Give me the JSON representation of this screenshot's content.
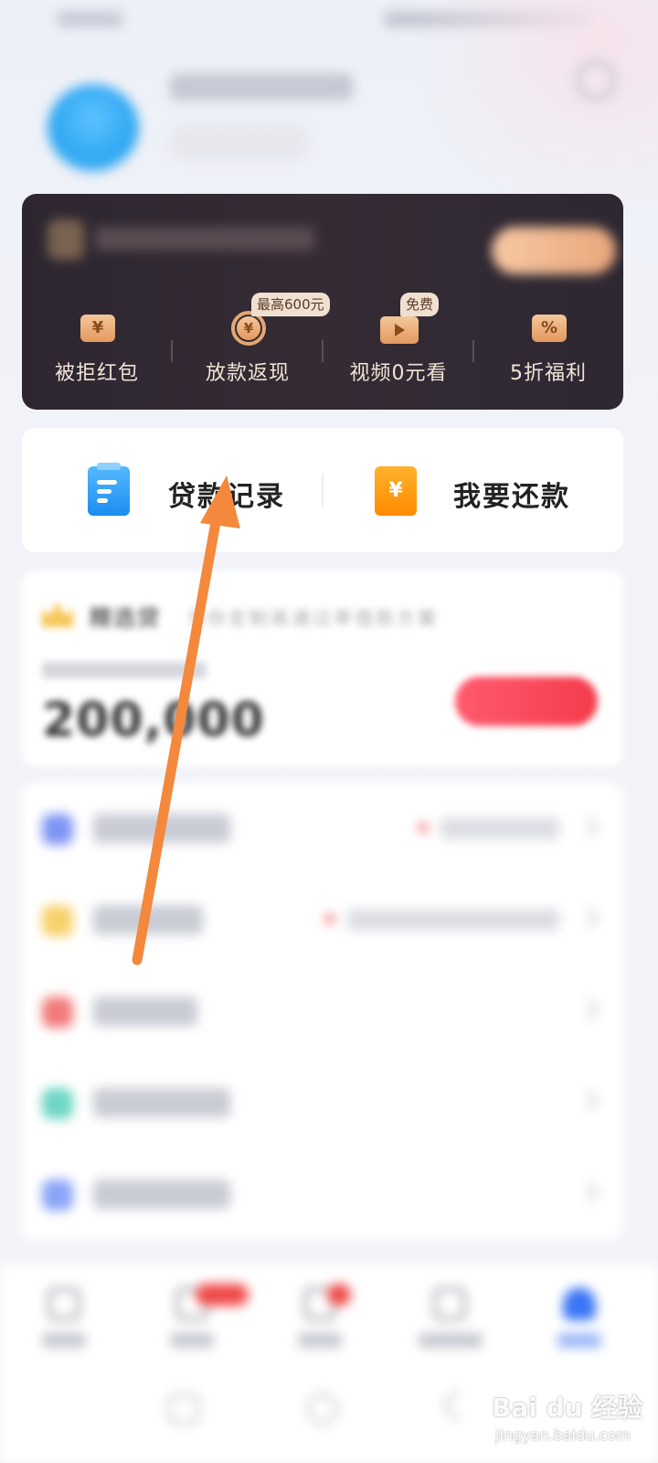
{
  "status_bar": {
    "time": "",
    "icons": ""
  },
  "profile": {
    "username": "",
    "member_tag": ""
  },
  "vip": {
    "title": "",
    "open_button": "",
    "benefits": [
      {
        "label": "被拒红包",
        "icon": "yen-ticket-icon"
      },
      {
        "label": "放款返现",
        "icon": "yen-coin-refresh-icon",
        "badge": "最高600元"
      },
      {
        "label": "视频0元看",
        "icon": "video-play-icon",
        "badge": "免费"
      },
      {
        "label": "5折福利",
        "icon": "percent-ticket-icon"
      }
    ],
    "colors": {
      "card": "#2f2832",
      "accent": "#e8a67c",
      "label": "#f2e4d6"
    }
  },
  "quick_actions": {
    "loan_record": {
      "label": "贷款记录",
      "icon": "document-icon",
      "color": "#1c8cf0"
    },
    "repay": {
      "label": "我要还款",
      "icon": "yen-card-icon",
      "glyph": "¥",
      "color": "#ff8a00"
    }
  },
  "selected_loan": {
    "title": "精选贷",
    "subtitle": "为你定制高通过率借款方案",
    "amount_hint": "",
    "amount": "200,000",
    "button": ""
  },
  "menu": {
    "items": [
      {
        "icon": "list-icon",
        "label": "",
        "extra": "",
        "color": "#7f95f5"
      },
      {
        "icon": "coupon-icon",
        "label": "",
        "extra": "",
        "color": "#f7d16a"
      },
      {
        "icon": "shield-icon",
        "label": "",
        "extra": "",
        "color": "#f27a7a"
      },
      {
        "icon": "help-icon",
        "label": "",
        "extra": "",
        "color": "#6fd6c4"
      },
      {
        "icon": "service-icon",
        "label": "",
        "extra": "",
        "color": "#8aa4f7"
      }
    ]
  },
  "bottom_nav": {
    "tabs": [
      {
        "icon": "home-icon",
        "label": ""
      },
      {
        "icon": "loan-icon",
        "label": "",
        "badge": ""
      },
      {
        "icon": "message-icon",
        "label": "",
        "badge": ""
      },
      {
        "icon": "card-icon",
        "label": ""
      },
      {
        "icon": "profile-icon",
        "label": "",
        "active": true
      }
    ]
  },
  "annotation": {
    "arrow_color": "#f4883c"
  },
  "watermark": {
    "brand": "Bai du 经验",
    "url": "jingyan.baidu.com"
  }
}
